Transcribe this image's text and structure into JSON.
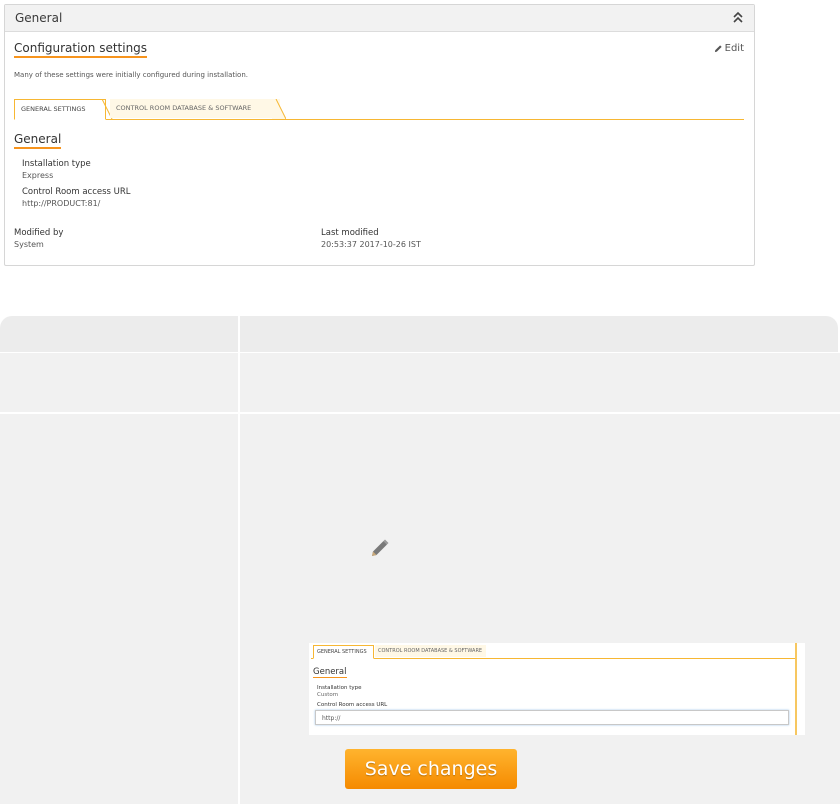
{
  "panel": {
    "title": "General",
    "config_title": "Configuration settings",
    "edit_label": "Edit",
    "description": "Many of these settings were initially configured during installation.",
    "tabs": [
      {
        "label": "GENERAL SETTINGS",
        "active": true
      },
      {
        "label": "CONTROL ROOM DATABASE & SOFTWARE",
        "active": false
      }
    ],
    "section_title": "General",
    "installation_type_label": "Installation type",
    "installation_type_value": "Express",
    "access_url_label": "Control Room access URL",
    "access_url_value": "http://PRODUCT:81/",
    "modified_by_label": "Modified by",
    "modified_by_value": "System",
    "last_modified_label": "Last modified",
    "last_modified_value": "20:53:37 2017-10-26 IST"
  },
  "mini": {
    "tabs": [
      {
        "label": "GENERAL SETTINGS",
        "active": true
      },
      {
        "label": "CONTROL ROOM DATABASE & SOFTWARE",
        "active": false
      }
    ],
    "section_title": "General",
    "installation_type_label": "Installation type",
    "installation_type_value": "Custom",
    "access_url_label": "Control Room access URL",
    "access_url_value": "http://"
  },
  "save_button_label": "Save changes",
  "colors": {
    "accent": "#f7941d",
    "tab_border": "#f7b733",
    "table_bg": "#f1f1f1",
    "button_top": "#ffb42e",
    "button_bottom": "#f58a00"
  },
  "icons": [
    "chevron-double-up-icon",
    "pencil-icon"
  ]
}
